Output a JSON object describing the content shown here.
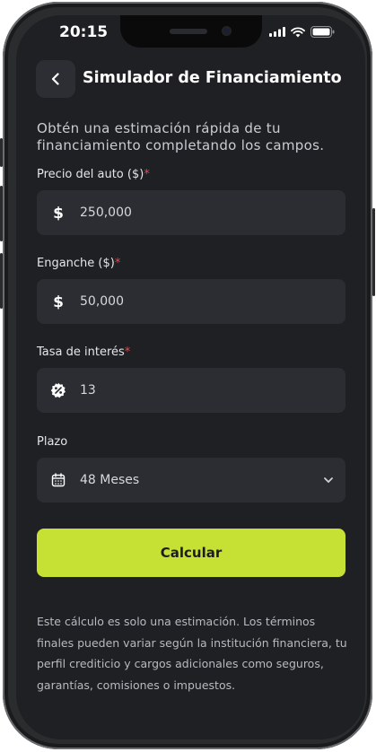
{
  "status_bar": {
    "time": "20:15"
  },
  "header": {
    "title": "Simulador de Financiamiento"
  },
  "intro": "Obtén una estimación rápida de tu financiamiento completando los campos.",
  "fields": {
    "price": {
      "label": "Precio del auto ($)",
      "required_mark": "*",
      "icon": "dollar-icon",
      "value": "250,000"
    },
    "down_payment": {
      "label": "Enganche ($)",
      "required_mark": "*",
      "icon": "dollar-icon",
      "value": "50,000"
    },
    "interest": {
      "label": "Tasa de interés",
      "required_mark": "*",
      "icon": "percent-badge-icon",
      "value": "13"
    },
    "term": {
      "label": "Plazo",
      "icon": "calendar-icon",
      "value": "48 Meses"
    }
  },
  "actions": {
    "calculate_label": "Calcular"
  },
  "disclaimer": "Este cálculo es solo una estimación. Los términos finales pueden variar según la institución financiera, tu perfil crediticio y cargos adicionales como seguros, garantías, comisiones o impuestos.",
  "colors": {
    "accent": "#c6e133",
    "background": "#1f2023",
    "field": "#2b2d32",
    "required": "#e5484d"
  }
}
